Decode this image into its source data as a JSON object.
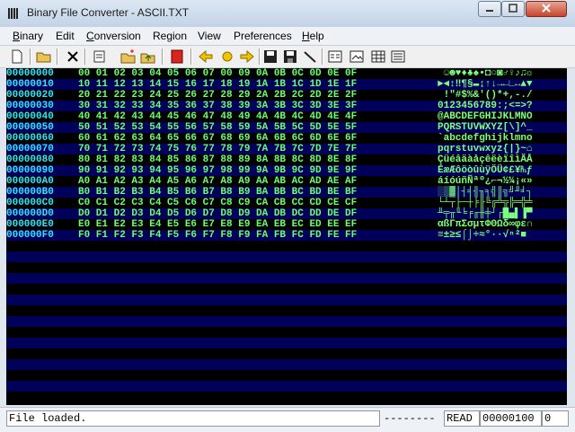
{
  "window": {
    "title": "Binary File Converter - ASCII.TXT"
  },
  "menu": [
    {
      "label": "Binary",
      "u": "B",
      "rest": "inary"
    },
    {
      "label": "Edit",
      "u": "",
      "rest": "Edit"
    },
    {
      "label": "Conversion",
      "u": "C",
      "rest": "onversion"
    },
    {
      "label": "Region",
      "u": "",
      "rest": "Region"
    },
    {
      "label": "View",
      "u": "",
      "rest": "View"
    },
    {
      "label": "Preferences",
      "u": "",
      "rest": "Preferences"
    },
    {
      "label": "Help",
      "u": "H",
      "rest": "elp"
    }
  ],
  "toolbar_icons": [
    "new-file-icon",
    "open-folder-icon",
    "delete-icon",
    "properties-icon",
    "new-folder-icon",
    "up-folder-icon",
    "stop-icon",
    "arrow-left-icon",
    "circle-icon",
    "arrow-right-icon",
    "save-icon",
    "save-as-icon",
    "wand-icon",
    "view-text-icon",
    "view-image-icon",
    "view-table-icon",
    "view-list-icon"
  ],
  "hex_rows": [
    {
      "address": "00000000",
      "bytes": "00 01 02 03 04 05 06 07 00 09 0A 0B 0C 0D 0E 0F",
      "ascii": " ☺☻♥♦♣♠•◘○◙♂♀♪♫☼"
    },
    {
      "address": "00000010",
      "bytes": "10 11 12 13 14 15 16 17 18 19 1A 1B 1C 1D 1E 1F",
      "ascii": "►◄↕‼¶§▬↨↑↓→←∟↔▲▼"
    },
    {
      "address": "00000020",
      "bytes": "20 21 22 23 24 25 26 27 28 29 2A 2B 2C 2D 2E 2F",
      "ascii": " !\"#$%&'()*+,-./"
    },
    {
      "address": "00000030",
      "bytes": "30 31 32 33 34 35 36 37 38 39 3A 3B 3C 3D 3E 3F",
      "ascii": "0123456789:;<=>?"
    },
    {
      "address": "00000040",
      "bytes": "40 41 42 43 44 45 46 47 48 49 4A 4B 4C 4D 4E 4F",
      "ascii": "@ABCDEFGHIJKLMNO"
    },
    {
      "address": "00000050",
      "bytes": "50 51 52 53 54 55 56 57 58 59 5A 5B 5C 5D 5E 5F",
      "ascii": "PQRSTUVWXYZ[\\]^_"
    },
    {
      "address": "00000060",
      "bytes": "60 61 62 63 64 65 66 67 68 69 6A 6B 6C 6D 6E 6F",
      "ascii": "`abcdefghijklmno"
    },
    {
      "address": "00000070",
      "bytes": "70 71 72 73 74 75 76 77 78 79 7A 7B 7C 7D 7E 7F",
      "ascii": "pqrstuvwxyz{|}~⌂"
    },
    {
      "address": "00000080",
      "bytes": "80 81 82 83 84 85 86 87 88 89 8A 8B 8C 8D 8E 8F",
      "ascii": "ÇüéâäàåçêëèïîìÄÅ"
    },
    {
      "address": "00000090",
      "bytes": "90 91 92 93 94 95 96 97 98 99 9A 9B 9C 9D 9E 9F",
      "ascii": "ÉæÆôöòûùÿÖÜ¢£¥₧ƒ"
    },
    {
      "address": "000000A0",
      "bytes": "A0 A1 A2 A3 A4 A5 A6 A7 A8 A9 AA AB AC AD AE AF",
      "ascii": "áíóúñÑªº¿⌐¬½¼¡«»"
    },
    {
      "address": "000000B0",
      "bytes": "B0 B1 B2 B3 B4 B5 B6 B7 B8 B9 BA BB BC BD BE BF",
      "ascii": "░▒▓│┤╡╢╖╕╣║╗╝╜╛┐"
    },
    {
      "address": "000000C0",
      "bytes": "C0 C1 C2 C3 C4 C5 C6 C7 C8 C9 CA CB CC CD CE CF",
      "ascii": "└┴┬├─┼╞╟╚╔╩╦╠═╬╧"
    },
    {
      "address": "000000D0",
      "bytes": "D0 D1 D2 D3 D4 D5 D6 D7 D8 D9 DA DB DC DD DE DF",
      "ascii": "╨╤╥╙╘╒╓╫╪┘┌█▄▌▐▀"
    },
    {
      "address": "000000E0",
      "bytes": "E0 E1 E2 E3 E4 E5 E6 E7 E8 E9 EA EB EC ED EE EF",
      "ascii": "αßΓπΣσµτΦΘΩδ∞φε∩"
    },
    {
      "address": "000000F0",
      "bytes": "F0 F1 F2 F3 F4 F5 F6 F7 F8 F9 FA FB FC FD FE FF",
      "ascii": "≡±≥≤⌠⌡÷≈°∙·√ⁿ²■ "
    }
  ],
  "status": {
    "message": "File loaded.",
    "dashes": "--------",
    "mode": "READ",
    "position": "00000100",
    "extra": "0"
  },
  "colors": {
    "address": "#2ee6ff",
    "bytes": "#6cff6c",
    "ascii": "#7dff7d",
    "band": "#00005a"
  }
}
